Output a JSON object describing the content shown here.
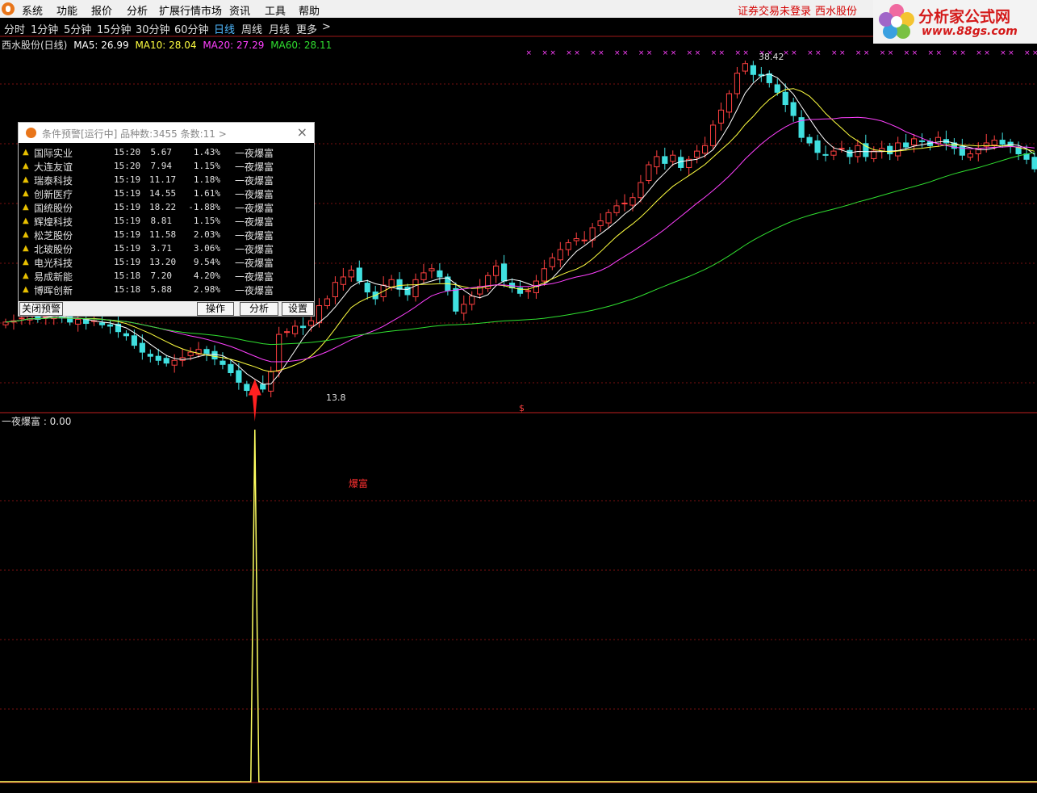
{
  "menu": {
    "items": [
      "系统",
      "功能",
      "报价",
      "分析",
      "扩展行情市场",
      "资讯",
      "工具",
      "帮助"
    ],
    "login_status": "证券交易未登录",
    "stock_name": "西水股份"
  },
  "brand": {
    "title": "分析家公式网",
    "url": "www.88gs.com"
  },
  "periods": {
    "items": [
      "分时",
      "1分钟",
      "5分钟",
      "15分钟",
      "30分钟",
      "60分钟",
      "日线",
      "周线",
      "月线",
      "更多"
    ],
    "active": "日线",
    "more_arrow": ">"
  },
  "info": {
    "title": "西水股份(日线)",
    "ma5": "MA5: 26.99",
    "ma10": "MA10: 28.04",
    "ma20": "MA20: 27.29",
    "ma60": "MA60: 28.11"
  },
  "colors": {
    "ma5": "#ffffff",
    "ma10": "#ffff40",
    "ma20": "#ff40ff",
    "ma60": "#30e030",
    "up": "#ff4040",
    "down": "#40e0e0",
    "accent": "#4fb9ff",
    "indicator": "#ffff60"
  },
  "price_labels": {
    "high": "38.42",
    "low": "13.8",
    "signal_mark": "$"
  },
  "indicator": {
    "label": "一夜爆富 : 0.00",
    "signal_text": "爆富"
  },
  "alert": {
    "title": "条件预警[运行中] 品种数:3455 条数:11  >",
    "close_icon": "×",
    "rows": [
      {
        "name": "国际实业",
        "time": "15:20",
        "price": "5.67",
        "pct": "1.43%",
        "signal": "一夜爆富"
      },
      {
        "name": "大连友谊",
        "time": "15:20",
        "price": "7.94",
        "pct": "1.15%",
        "signal": "一夜爆富"
      },
      {
        "name": "瑞泰科技",
        "time": "15:19",
        "price": "11.17",
        "pct": "1.18%",
        "signal": "一夜爆富"
      },
      {
        "name": "创新医疗",
        "time": "15:19",
        "price": "14.55",
        "pct": "1.61%",
        "signal": "一夜爆富"
      },
      {
        "name": "国统股份",
        "time": "15:19",
        "price": "18.22",
        "pct": "-1.88%",
        "signal": "一夜爆富"
      },
      {
        "name": "辉煌科技",
        "time": "15:19",
        "price": "8.81",
        "pct": "1.15%",
        "signal": "一夜爆富"
      },
      {
        "name": "松芝股份",
        "time": "15:19",
        "price": "11.58",
        "pct": "2.03%",
        "signal": "一夜爆富"
      },
      {
        "name": "北玻股份",
        "time": "15:19",
        "price": "3.71",
        "pct": "3.06%",
        "signal": "一夜爆富"
      },
      {
        "name": "电光科技",
        "time": "15:19",
        "price": "13.20",
        "pct": "9.54%",
        "signal": "一夜爆富"
      },
      {
        "name": "易成新能",
        "time": "15:18",
        "price": "7.20",
        "pct": "4.20%",
        "signal": "一夜爆富"
      },
      {
        "name": "博晖创新",
        "time": "15:18",
        "price": "5.88",
        "pct": "2.98%",
        "signal": "一夜爆富"
      }
    ],
    "buttons": {
      "close": "关闭预警",
      "operate": "操作",
      "analyze": "分析",
      "settings": "设置"
    }
  },
  "chart_data": {
    "type": "candlestick",
    "title": "西水股份(日线)",
    "ylim": [
      13.8,
      38.42
    ],
    "moving_averages": {
      "MA5": 26.99,
      "MA10": 28.04,
      "MA20": 27.29,
      "MA60": 28.11
    },
    "close": [
      19.3,
      19.4,
      19.6,
      19.9,
      19.5,
      19.7,
      19.9,
      19.6,
      19.3,
      19.5,
      19.2,
      19.4,
      19.1,
      19.0,
      18.6,
      18.3,
      17.6,
      17.1,
      16.8,
      16.5,
      16.3,
      16.5,
      16.7,
      17.1,
      17.3,
      17.0,
      16.6,
      16.2,
      15.6,
      14.9,
      14.3,
      14.6,
      14.4,
      15.7,
      18.4,
      18.6,
      19.0,
      18.9,
      19.4,
      20.5,
      21.0,
      22.2,
      22.6,
      23.1,
      22.3,
      21.5,
      21.0,
      22.0,
      22.4,
      21.7,
      21.3,
      22.4,
      22.9,
      23.2,
      22.6,
      21.6,
      20.1,
      20.6,
      21.2,
      21.9,
      22.7,
      23.4,
      22.3,
      21.8,
      21.4,
      21.6,
      22.3,
      23.2,
      24.0,
      24.6,
      25.1,
      25.4,
      25.3,
      26.2,
      26.7,
      27.3,
      27.8,
      28.0,
      28.4,
      29.5,
      30.8,
      31.4,
      30.9,
      31.5,
      30.6,
      31.2,
      31.8,
      32.2,
      33.7,
      34.8,
      36.0,
      37.5,
      38.2,
      37.4,
      37.3,
      36.8,
      36.1,
      35.2,
      34.4,
      32.8,
      32.4,
      31.7,
      31.5,
      31.8,
      32.0,
      31.4,
      32.2,
      31.4,
      31.8,
      32.0,
      31.6,
      32.4,
      32.1,
      32.7,
      32.5,
      32.2,
      32.8,
      32.4,
      32.0,
      31.5,
      31.6,
      32.0,
      32.4,
      32.6,
      32.3,
      32.2,
      31.6,
      31.2,
      30.5
    ]
  }
}
